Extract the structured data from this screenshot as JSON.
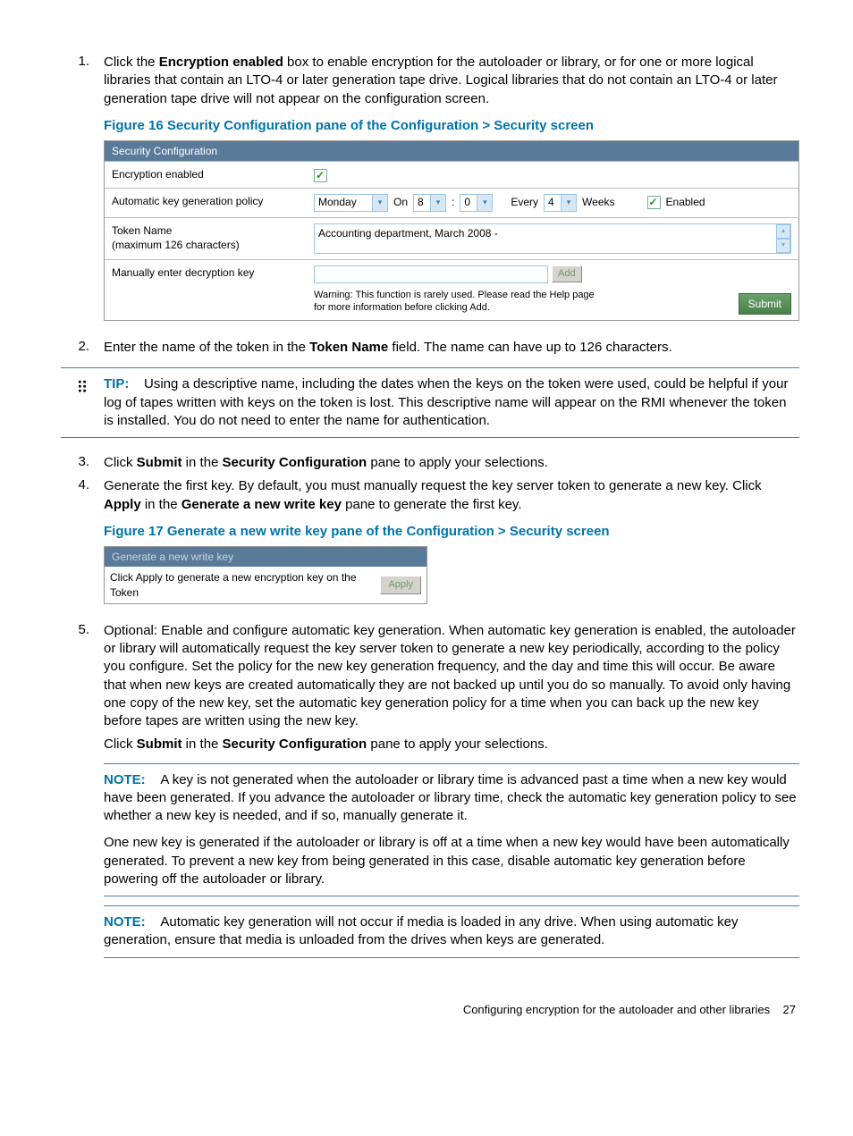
{
  "steps": {
    "s1": {
      "num": "1.",
      "intro": "Click the ",
      "bold1": "Encryption enabled",
      "rest": " box to enable encryption for the autoloader or library, or for one or more logical libraries that contain an LTO-4 or later generation tape drive. Logical libraries that do not contain an LTO-4 or later generation tape drive will not appear on the configuration screen."
    },
    "fig16_caption": "Figure 16 Security Configuration pane of the Configuration > Security screen",
    "shot1": {
      "header": "Security Configuration",
      "row1_label": "Encryption enabled",
      "row2_label": "Automatic key generation policy",
      "row2_day": "Monday",
      "row2_on": "On",
      "row2_hour": "8",
      "row2_min": "0",
      "row2_every": "Every",
      "row2_weeks_val": "4",
      "row2_weeks": "Weeks",
      "row2_enabled": "Enabled",
      "row3_label1": "Token Name",
      "row3_label2": "(maximum 126 characters)",
      "row3_text": "Accounting department, March 2008 -",
      "row4_label": "Manually enter decryption key",
      "row4_add": "Add",
      "row4_warn1": "Warning: This function is rarely used. Please read the Help page",
      "row4_warn2": "for more information before clicking Add.",
      "row4_submit": "Submit"
    },
    "s2": {
      "num": "2.",
      "p1": "Enter the name of the token in the ",
      "b1": "Token Name",
      "p2": " field. The name can have up to 126 characters."
    },
    "tip": {
      "label": "TIP:",
      "text": "Using a descriptive name, including the dates when the keys on the token were used, could be helpful if your log of tapes written with keys on the token is lost. This descriptive name will appear on the RMI whenever the token is installed. You do not need to enter the name for authentication."
    },
    "s3": {
      "num": "3.",
      "p1": "Click ",
      "b1": "Submit",
      "p2": " in the ",
      "b2": "Security Configuration",
      "p3": " pane to apply your selections."
    },
    "s4": {
      "num": "4.",
      "p1": "Generate the first key. By default, you must manually request the key server token to generate a new key. Click ",
      "b1": "Apply",
      "p2": " in the ",
      "b2": "Generate a new write key",
      "p3": " pane to generate the first key."
    },
    "fig17_caption": "Figure 17 Generate a new write key pane of the Configuration > Security screen",
    "shot2": {
      "header": "Generate a new write key",
      "label": "Click Apply to generate a new encryption key on the Token",
      "apply": "Apply"
    },
    "s5": {
      "num": "5.",
      "p1": "Optional: Enable and configure automatic key generation. When automatic key generation is enabled, the autoloader or library will automatically request the key server token to generate a new key periodically, according to the policy you configure. Set the policy for the new key generation frequency, and the day and time this will occur. Be aware that when new keys are created automatically they are not backed up until you do so manually. To avoid only having one copy of the new key, set the automatic key generation policy for a time when you can back up the new key before tapes are written using the new key.",
      "p2a": "Click ",
      "p2b1": "Submit",
      "p2c": " in the ",
      "p2b2": "Security Configuration",
      "p2d": " pane to apply your selections."
    },
    "note1": {
      "label": "NOTE:",
      "p1": "A key is not generated when the autoloader or library time is advanced past a time when a new key would have been generated. If you advance the autoloader or library time, check the automatic key generation policy to see whether a new key is needed, and if so, manually generate it.",
      "p2": "One new key is generated if the autoloader or library is off at a time when a new key would have been automatically generated. To prevent a new key from being generated in this case, disable automatic key generation before powering off the autoloader or library."
    },
    "note2": {
      "label": "NOTE:",
      "p1": "Automatic key generation will not occur if media is loaded in any drive. When using automatic key generation, ensure that media is unloaded from the drives when keys are generated."
    }
  },
  "footer": {
    "text": "Configuring encryption for the autoloader and other libraries",
    "page": "27"
  }
}
